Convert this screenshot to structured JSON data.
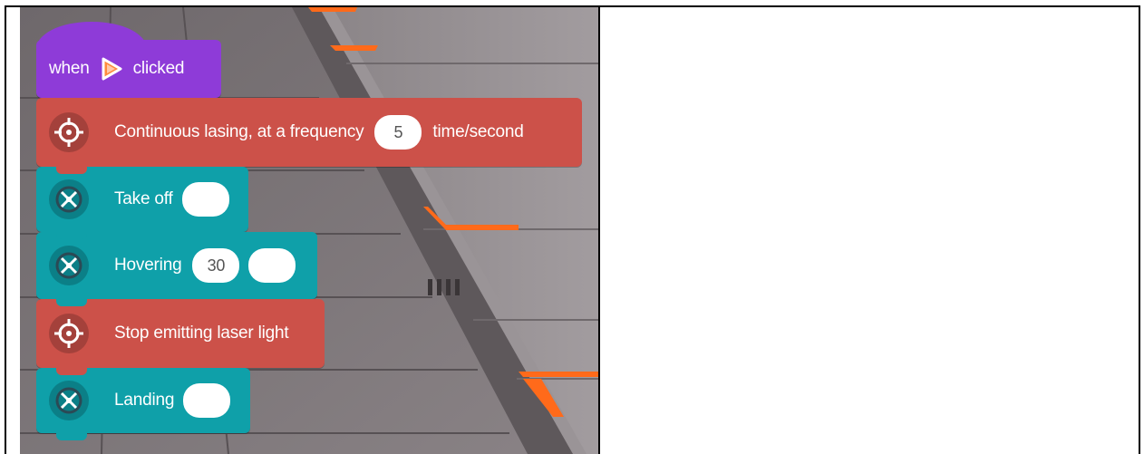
{
  "page": {
    "left_panel": "block-editor-scene",
    "right_panel": "empty"
  },
  "blocks": {
    "hat": {
      "when_label": "when",
      "clicked_label": "clicked",
      "icon": "play-flag-icon",
      "color": "#8e3bd8"
    },
    "laser_continuous": {
      "label": "Continuous lasing, at a frequency",
      "value": "5",
      "unit": "time/second",
      "icon": "crosshair-icon",
      "color": "#cc5149"
    },
    "take_off": {
      "label": "Take off",
      "value": "",
      "icon": "drone-icon",
      "color": "#0fa0a9"
    },
    "hovering": {
      "label": "Hovering",
      "value": "30",
      "extra_value": "",
      "icon": "drone-icon",
      "color": "#0fa0a9"
    },
    "stop_laser": {
      "label": "Stop emitting laser light",
      "icon": "crosshair-icon",
      "color": "#cc5149"
    },
    "landing": {
      "label": "Landing",
      "value": "",
      "icon": "drone-icon",
      "color": "#0fa0a9"
    }
  },
  "colors": {
    "orange_accent": "#ff6a1a",
    "scene_gray": "#7c7578"
  }
}
